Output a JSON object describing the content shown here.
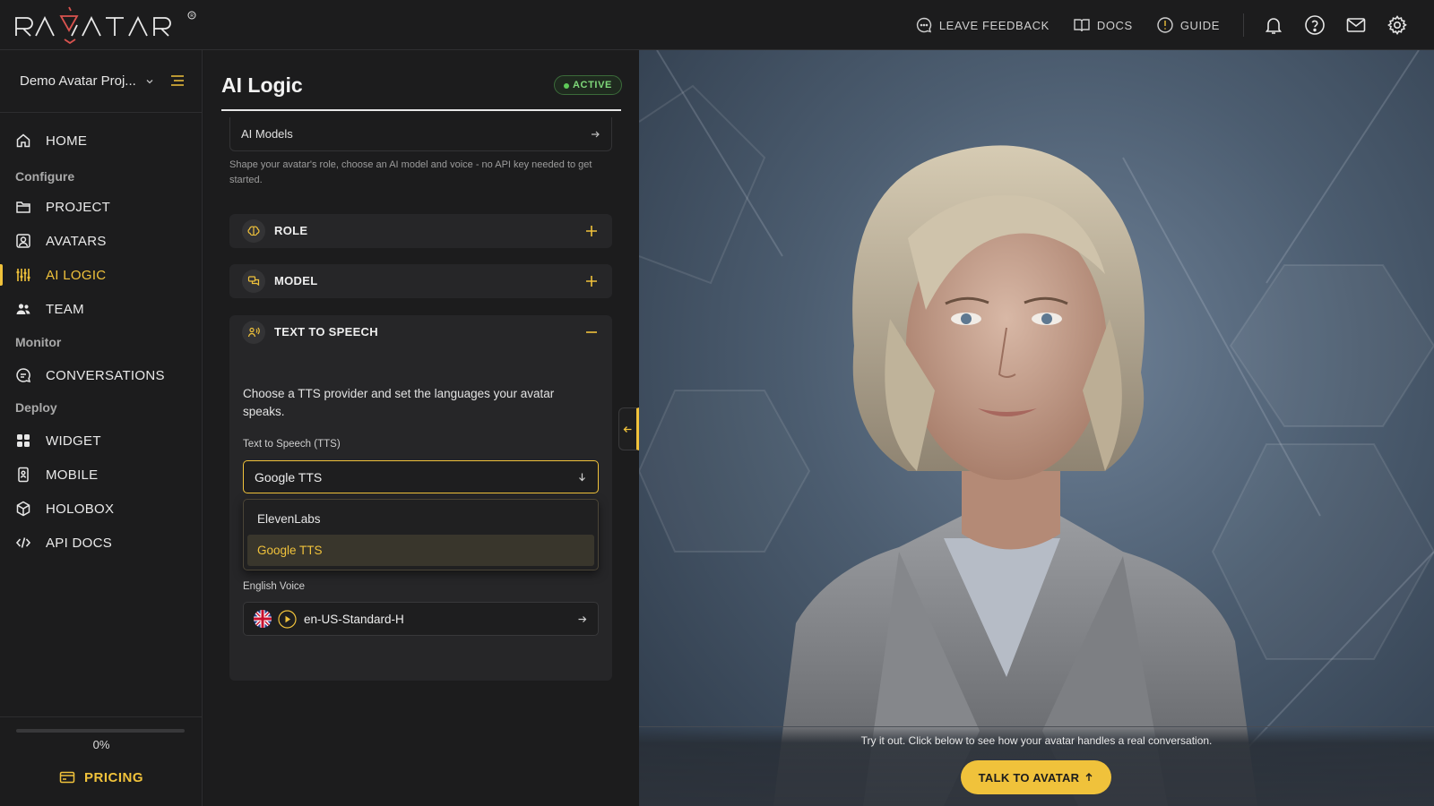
{
  "brand": {
    "logo_text": "RAVATAR"
  },
  "topbar": {
    "feedback_label": "LEAVE FEEDBACK",
    "docs_label": "DOCS",
    "guide_label": "GUIDE"
  },
  "sidebar": {
    "project_name": "Demo Avatar Proj...",
    "home": "HOME",
    "section_configure": "Configure",
    "project": "PROJECT",
    "avatars": "AVATARS",
    "ai_logic": "AI LOGIC",
    "team": "TEAM",
    "section_monitor": "Monitor",
    "conversations": "CONVERSATIONS",
    "section_deploy": "Deploy",
    "widget": "WIDGET",
    "mobile": "MOBILE",
    "holobox": "HOLOBOX",
    "api_docs": "API DOCS",
    "progress_text": "0%",
    "progress_value": 0,
    "pricing": "PRICING"
  },
  "panel": {
    "title": "AI Logic",
    "status": "ACTIVE",
    "models_label": "AI Models",
    "help_text": "Shape your avatar's role, choose an AI model and voice - no API key needed to get started.",
    "role_label": "ROLE",
    "model_label": "MODEL",
    "tts_label": "TEXT TO SPEECH",
    "tts_description": "Choose a TTS provider and set the languages your avatar speaks.",
    "tts_field_label": "Text to Speech (TTS)",
    "tts_selected": "Google TTS",
    "tts_options": [
      "ElevenLabs",
      "Google TTS"
    ],
    "voice_label": "English Voice",
    "voice_value": "en-US-Standard-H"
  },
  "stage": {
    "hint": "Try it out. Click below to see how your avatar handles a real conversation.",
    "talk_button": "TALK TO AVATAR"
  },
  "colors": {
    "accent": "#f0c23b",
    "active_green": "#5ecb58",
    "background": "#1c1c1d"
  }
}
